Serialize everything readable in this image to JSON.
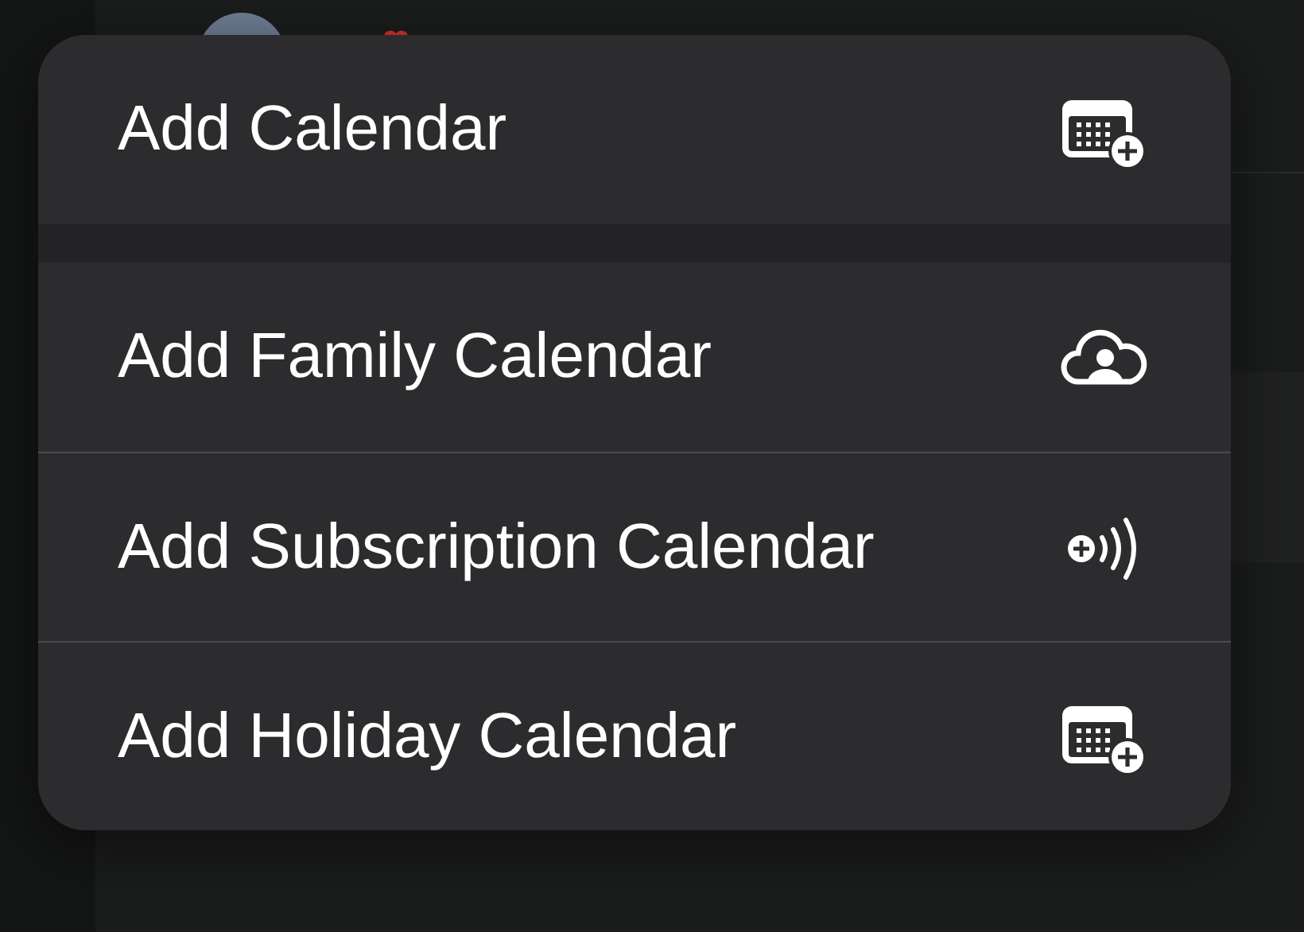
{
  "menu": {
    "sections": [
      {
        "items": [
          {
            "label": "Add Calendar",
            "kind": "calendar"
          }
        ]
      },
      {
        "items": [
          {
            "label": "Add Family Calendar",
            "kind": "family"
          },
          {
            "label": "Add Subscription Calendar",
            "kind": "subscription"
          },
          {
            "label": "Add Holiday Calendar",
            "kind": "calendar"
          }
        ]
      }
    ]
  }
}
